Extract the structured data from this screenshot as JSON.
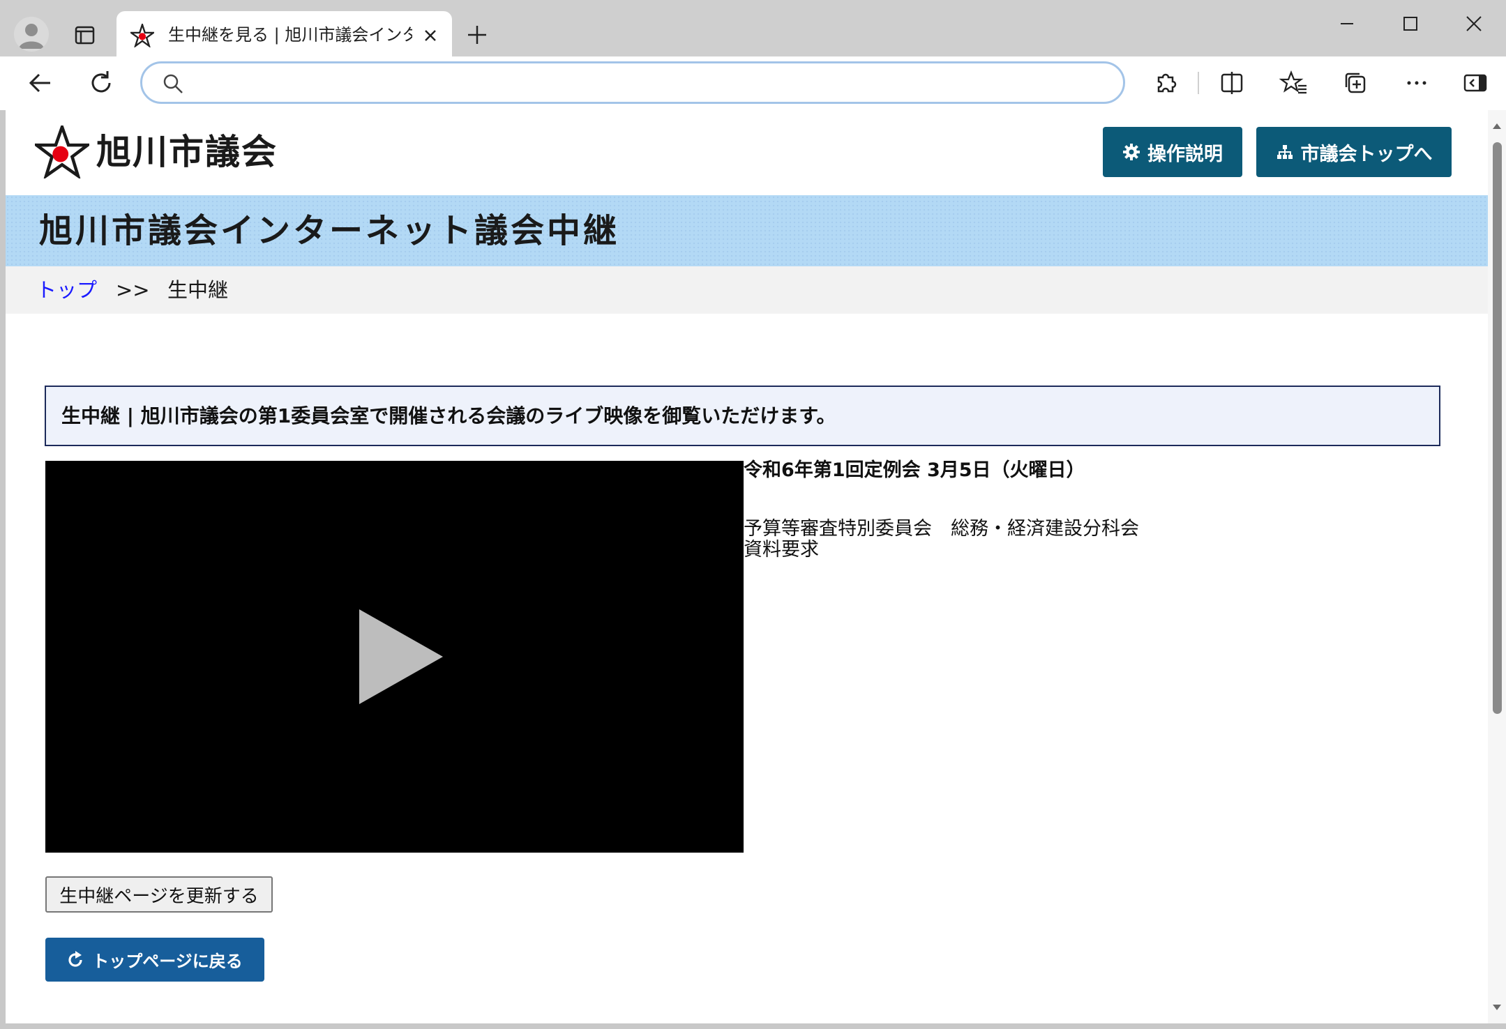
{
  "browser": {
    "tab": {
      "title": "生中継を見る | 旭川市議会インターネット議会中継"
    },
    "address": {
      "value": "",
      "placeholder": ""
    }
  },
  "site": {
    "logo_text": "旭川市議会",
    "header_buttons": {
      "help": "操作説明",
      "council_top": "市議会トップへ"
    },
    "banner_title": "旭川市議会インターネット議会中継"
  },
  "breadcrumb": {
    "top": "トップ",
    "separator": ">>",
    "current": "生中継"
  },
  "notice": "生中継 | 旭川市議会の第1委員会室で開催される会議のライブ映像を御覧いただけます。",
  "meeting": {
    "title": "令和6年第1回定例会 3月5日（火曜日）",
    "committee": "予算等審査特別委員会　総務・経済建設分科会",
    "topic": "資料要求"
  },
  "buttons": {
    "refresh": "生中継ページを更新する",
    "back_top": "トップページに戻る"
  },
  "colors": {
    "header_button": "#0c5a78",
    "back_button": "#175e9b",
    "banner": "#b3d9f5",
    "link": "#1a1aff",
    "logo_star_dot": "#e60012"
  },
  "icons": {
    "help": "gear-icon",
    "council_top": "sitemap-icon",
    "back_top": "return-arrow-icon",
    "video": "play-icon"
  }
}
